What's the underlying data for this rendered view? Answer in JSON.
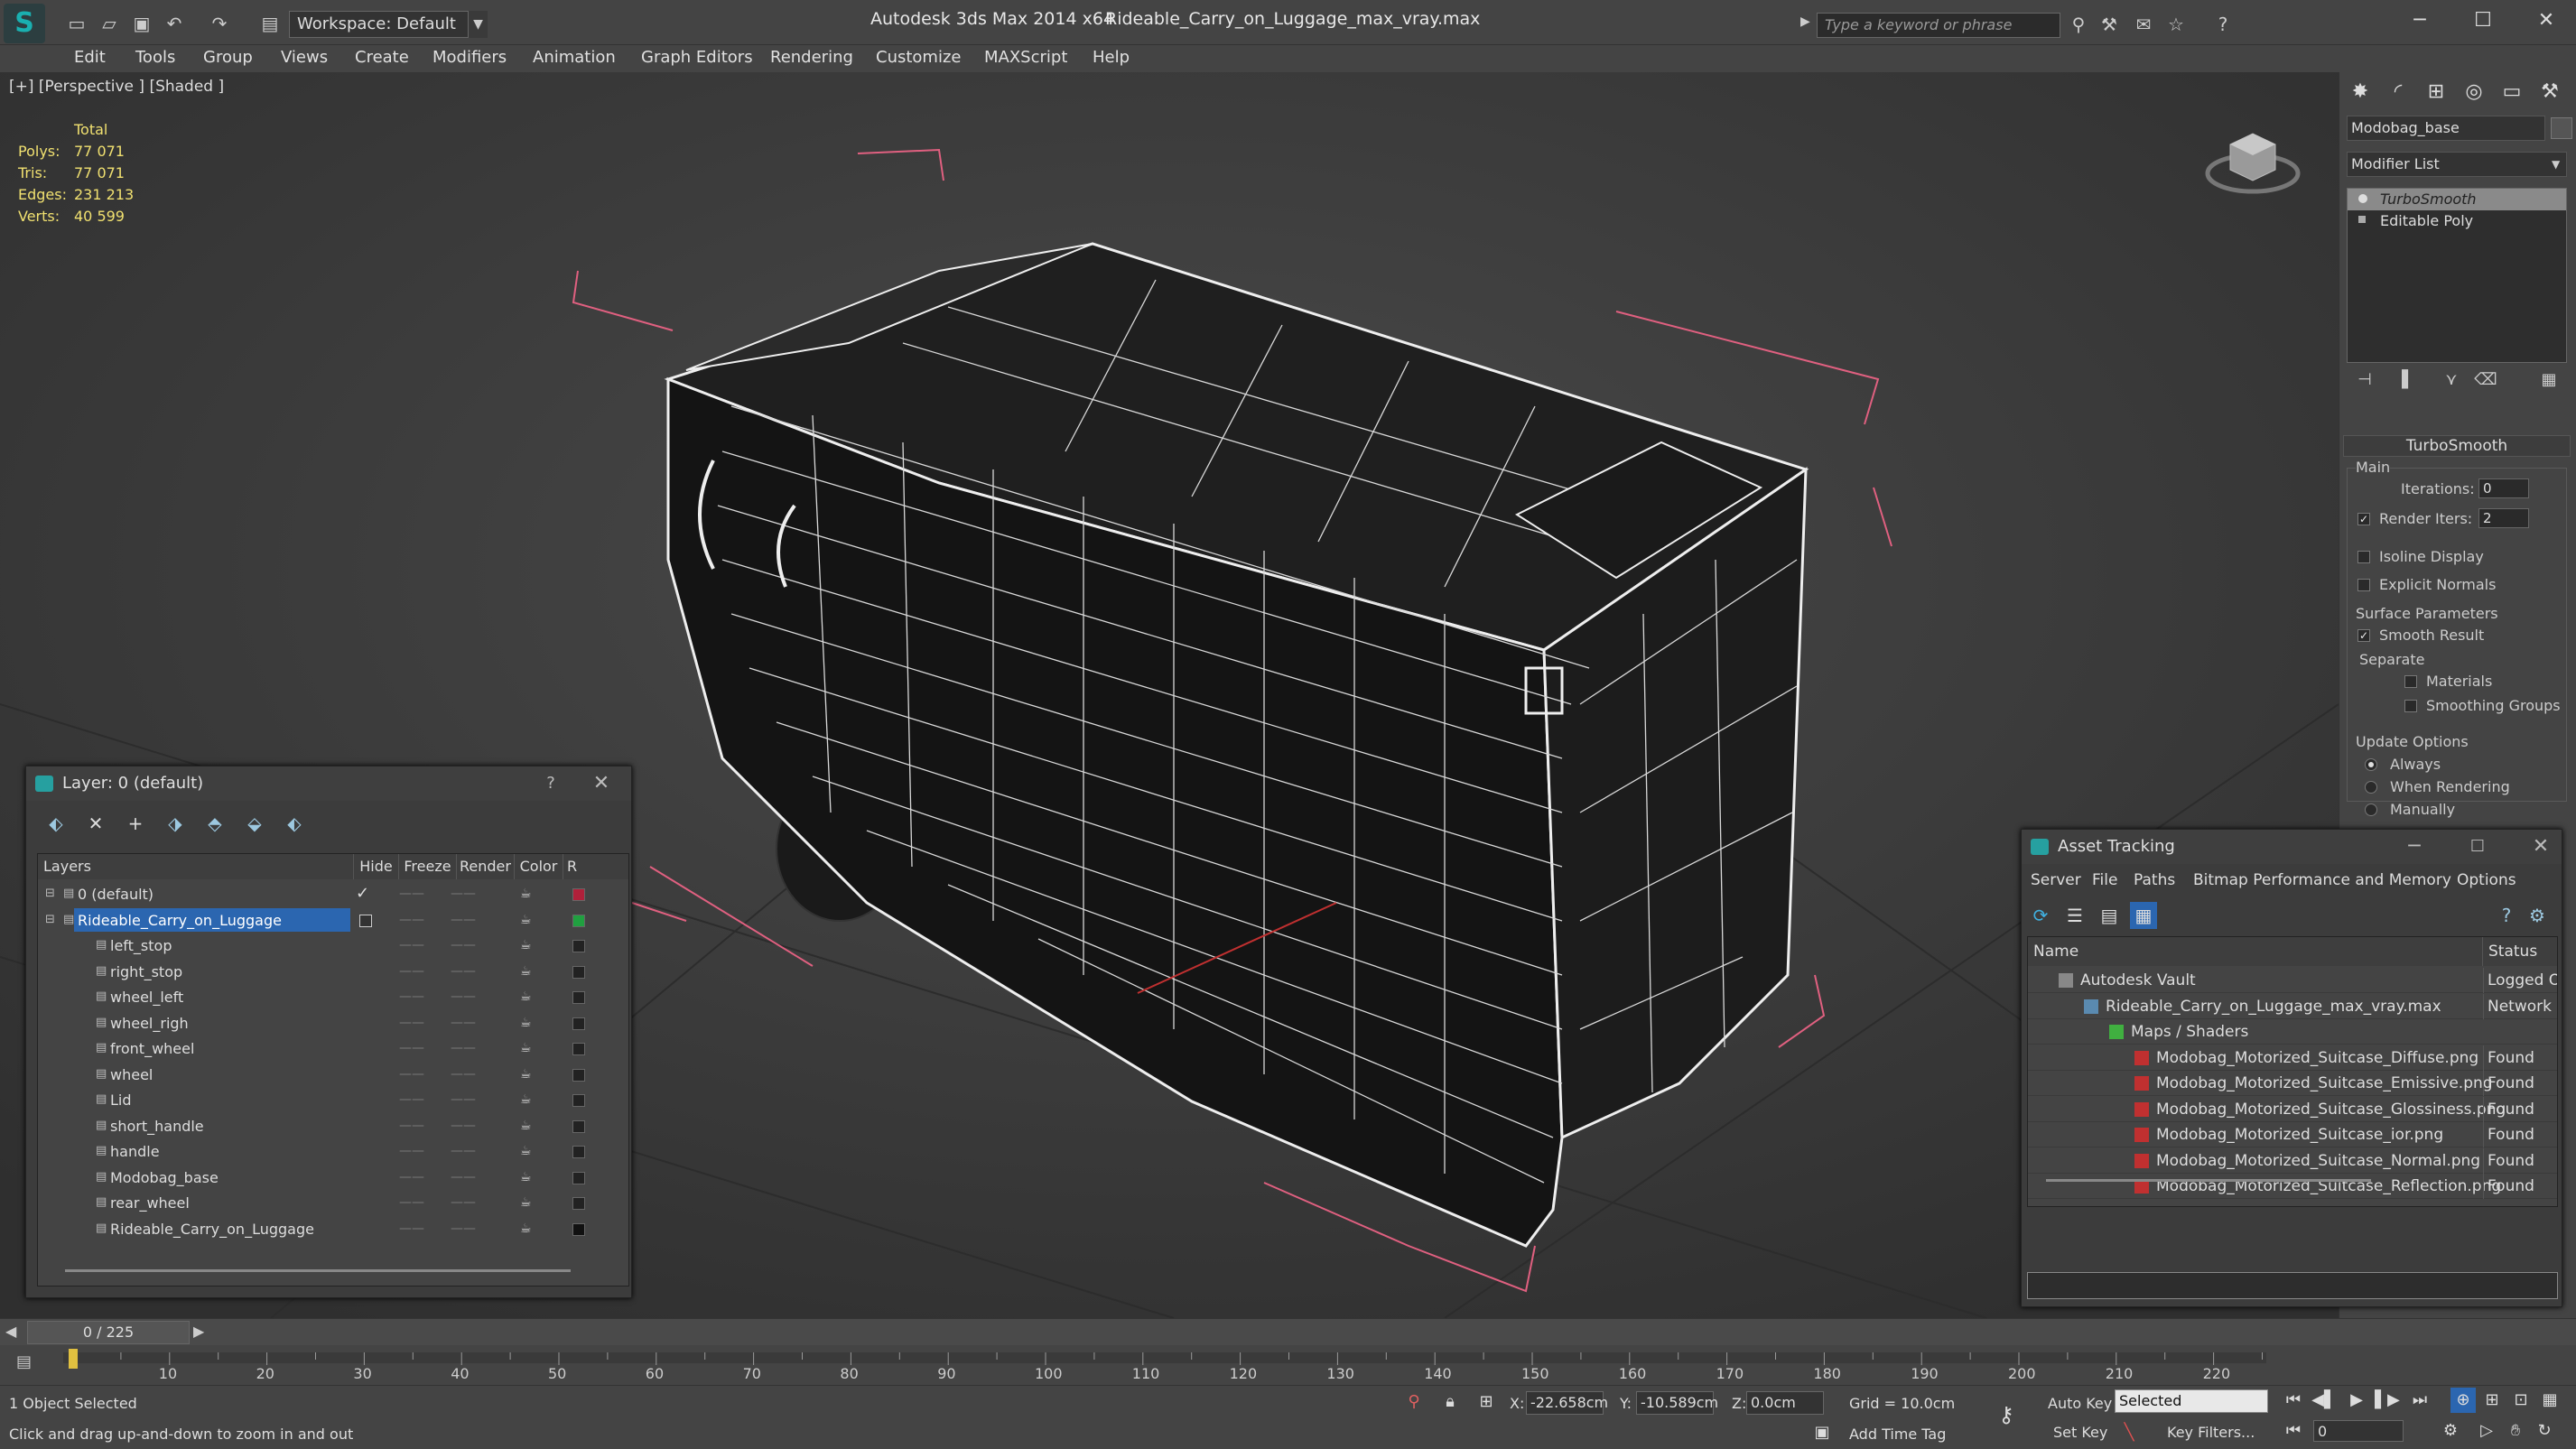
{
  "titlebar": {
    "workspace": "Workspace: Default",
    "app_title": "Autodesk 3ds Max  2014 x64",
    "file_title": "Rideable_Carry_on_Luggage_max_vray.max",
    "search_placeholder": "Type a keyword or phrase"
  },
  "menu": [
    "Edit",
    "Tools",
    "Group",
    "Views",
    "Create",
    "Modifiers",
    "Animation",
    "Graph Editors",
    "Rendering",
    "Customize",
    "MAXScript",
    "Help"
  ],
  "viewport": {
    "label": "[+] [Perspective ] [Shaded ]",
    "stats_header": "Total",
    "stats": [
      {
        "label": "Polys:",
        "value": "77 071"
      },
      {
        "label": "Tris:",
        "value": "77 071"
      },
      {
        "label": "Edges:",
        "value": "231 213"
      },
      {
        "label": "Verts:",
        "value": "40 599"
      }
    ]
  },
  "command_panel": {
    "object_name": "Modobag_base",
    "modifier_list": "Modifier List",
    "stack": [
      "TurboSmooth",
      "Editable Poly"
    ],
    "turbosmooth": {
      "title": "TurboSmooth",
      "main": "Main",
      "iterations_label": "Iterations:",
      "iterations": "0",
      "render_iters_label": "Render Iters:",
      "render_iters": "2",
      "isoline": "Isoline Display",
      "explicit": "Explicit Normals",
      "surface": "Surface Parameters",
      "smooth_result": "Smooth Result",
      "separate": "Separate",
      "materials": "Materials",
      "smoothing_groups": "Smoothing Groups",
      "update": "Update Options",
      "always": "Always",
      "when_rendering": "When Rendering",
      "manually": "Manually"
    }
  },
  "layer_window": {
    "title": "Layer: 0 (default)",
    "help": "?",
    "columns": [
      "Layers",
      "Hide",
      "Freeze",
      "Render",
      "Color",
      "R"
    ],
    "rows": [
      {
        "name": "0 (default)",
        "level": 0,
        "color": "#b0203a"
      },
      {
        "name": "Rideable_Carry_on_Luggage",
        "level": 0,
        "color": "#20a040"
      },
      {
        "name": "left_stop",
        "level": 1,
        "color": "#222222"
      },
      {
        "name": "right_stop",
        "level": 1,
        "color": "#222222"
      },
      {
        "name": "wheel_left",
        "level": 1,
        "color": "#222222"
      },
      {
        "name": "wheel_righ",
        "level": 1,
        "color": "#222222"
      },
      {
        "name": "front_wheel",
        "level": 1,
        "color": "#222222"
      },
      {
        "name": "wheel",
        "level": 1,
        "color": "#222222"
      },
      {
        "name": "Lid",
        "level": 1,
        "color": "#222222"
      },
      {
        "name": "short_handle",
        "level": 1,
        "color": "#222222"
      },
      {
        "name": "handle",
        "level": 1,
        "color": "#222222"
      },
      {
        "name": "Modobag_base",
        "level": 1,
        "color": "#222222"
      },
      {
        "name": "rear_wheel",
        "level": 1,
        "color": "#222222"
      },
      {
        "name": "Rideable_Carry_on_Luggage",
        "level": 1,
        "color": "#111111"
      }
    ]
  },
  "asset_window": {
    "title": "Asset Tracking",
    "menu": [
      "Server",
      "File",
      "Paths",
      "Bitmap Performance and Memory",
      "Options"
    ],
    "columns": [
      "Name",
      "Status"
    ],
    "rows": [
      {
        "name": "Autodesk Vault",
        "status": "Logged O",
        "level": 0
      },
      {
        "name": "Rideable_Carry_on_Luggage_max_vray.max",
        "status": "Network",
        "level": 1
      },
      {
        "name": "Maps / Shaders",
        "status": "",
        "level": 2
      },
      {
        "name": "Modobag_Motorized_Suitcase_Diffuse.png",
        "status": "Found",
        "level": 3
      },
      {
        "name": "Modobag_Motorized_Suitcase_Emissive.png",
        "status": "Found",
        "level": 3
      },
      {
        "name": "Modobag_Motorized_Suitcase_Glossiness.png",
        "status": "Found",
        "level": 3
      },
      {
        "name": "Modobag_Motorized_Suitcase_ior.png",
        "status": "Found",
        "level": 3
      },
      {
        "name": "Modobag_Motorized_Suitcase_Normal.png",
        "status": "Found",
        "level": 3
      },
      {
        "name": "Modobag_Motorized_Suitcase_Reflection.png",
        "status": "Found",
        "level": 3
      }
    ]
  },
  "timeline": {
    "frame_counter": "0 / 225",
    "ticks": [
      "10",
      "20",
      "30",
      "40",
      "50",
      "60",
      "70",
      "80",
      "90",
      "100",
      "110",
      "120",
      "130",
      "140",
      "150",
      "160",
      "170",
      "180",
      "190",
      "200",
      "210",
      "220"
    ]
  },
  "statusbar": {
    "selection": "1 Object Selected",
    "hint": "Click and drag up-and-down to zoom in and out",
    "x_label": "X:",
    "x": "-22.658cm",
    "y_label": "Y:",
    "y": "-10.589cm",
    "z_label": "Z:",
    "z": "0.0cm",
    "grid": "Grid = 10.0cm",
    "add_time_tag": "Add Time Tag",
    "auto_key": "Auto Key",
    "set_key": "Set Key",
    "selected": "Selected",
    "key_filters": "Key Filters...",
    "frame": "0"
  }
}
